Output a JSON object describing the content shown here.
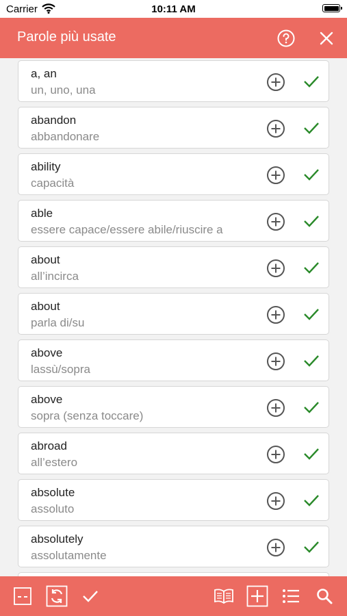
{
  "status_bar": {
    "carrier": "Carrier",
    "time": "10:11 AM"
  },
  "header": {
    "title": "Parole più usate",
    "icons": [
      "help-circle-icon",
      "close-icon"
    ]
  },
  "colors": {
    "accent": "#ec6b61",
    "check": "#2a8a2a",
    "card_border": "#d6d6d6",
    "translation": "#8a8a8a"
  },
  "words": [
    {
      "term": "a, an",
      "translation": "un, uno, una"
    },
    {
      "term": "abandon",
      "translation": "abbandonare"
    },
    {
      "term": "ability",
      "translation": "capacità"
    },
    {
      "term": "able",
      "translation": "essere capace/essere abile/riuscire a"
    },
    {
      "term": "about",
      "translation": "all’incirca"
    },
    {
      "term": "about",
      "translation": "parla di/su"
    },
    {
      "term": "above",
      "translation": "lassù/sopra"
    },
    {
      "term": "above",
      "translation": "sopra (senza toccare)"
    },
    {
      "term": "abroad",
      "translation": "all’estero"
    },
    {
      "term": "absolute",
      "translation": "assoluto"
    },
    {
      "term": "absolutely",
      "translation": "assolutamente"
    }
  ],
  "toolbar": {
    "icons": [
      "collapse-icon",
      "sync-icon",
      "check-icon",
      "book-icon",
      "add-box-icon",
      "list-icon",
      "search-icon"
    ]
  }
}
